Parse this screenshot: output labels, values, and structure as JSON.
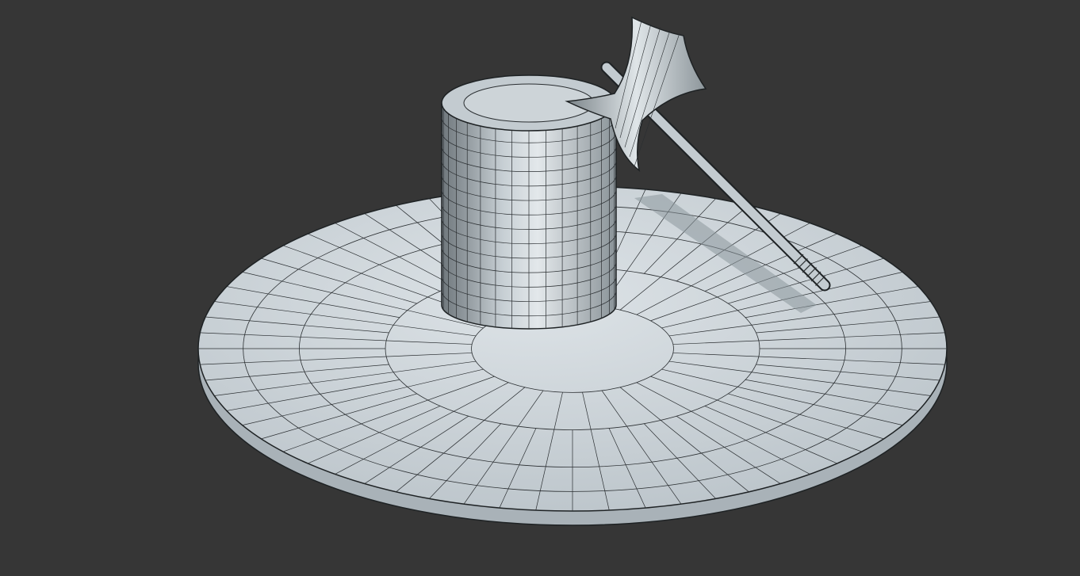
{
  "viewport": {
    "background_color": "#363636",
    "surface_color": "#c9d1d6",
    "wire_color": "#2a2e31",
    "objects": [
      "disc-base",
      "cylinder-stump",
      "battle-axe"
    ]
  }
}
